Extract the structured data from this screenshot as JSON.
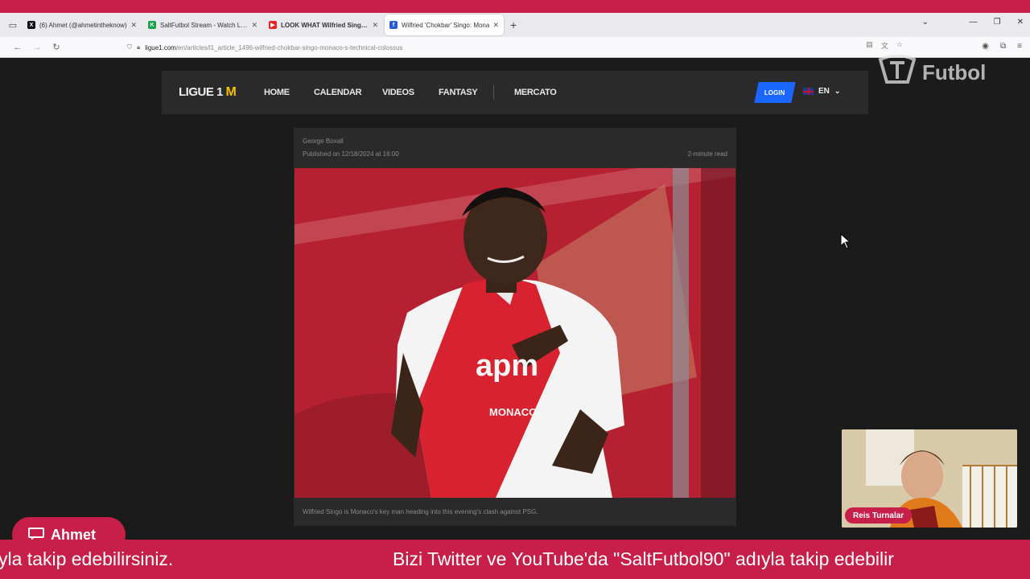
{
  "browser": {
    "tabs": [
      {
        "title": "(6) Ahmet (@ahmetintheknow)",
        "favicon_color": "#111111",
        "favicon_glyph": "X",
        "active": false
      },
      {
        "title": "SaltFutbol Stream - Watch Live",
        "favicon_color": "#17a34a",
        "favicon_glyph": "K",
        "active": false
      },
      {
        "title": "LOOK WHAT Wilfried Singo is",
        "favicon_color": "#e52222",
        "favicon_glyph": "▶",
        "active": false
      },
      {
        "title": "Wilfried 'Chokbar' Singo: Mona",
        "favicon_color": "#2a5bd7",
        "favicon_glyph": "f",
        "active": true
      }
    ],
    "new_tab": "+",
    "url_host": "ligue1.com",
    "url_path": "/en/articles/l1_article_1496-wilfried-chokbar-singo-monaco-s-technical-colossus"
  },
  "site": {
    "logo_text": "LIGUE 1",
    "logo_mc": "M",
    "nav": [
      "HOME",
      "CALENDAR",
      "VIDEOS",
      "FANTASY",
      "MERCATO"
    ],
    "login": "LOGIN",
    "lang": "EN"
  },
  "article": {
    "author": "George Boxall",
    "published": "Published on 12/18/2024 at 16:00",
    "read_time": "2-minute read",
    "caption": "Wilfried Singo is Monaco's key man heading into this evening's clash against PSG."
  },
  "overlay": {
    "brand": "Futbol",
    "webcam_name": "Reis Turnalar",
    "chat_user": "Ahmet",
    "ticker_left": "yla takip edebilirsiniz.",
    "ticker_right": "Bizi Twitter ve YouTube'da \"SaltFutbol90\" adıyla takip edebilir"
  },
  "colors": {
    "accent": "#c81e4a",
    "login": "#1a66ff"
  }
}
